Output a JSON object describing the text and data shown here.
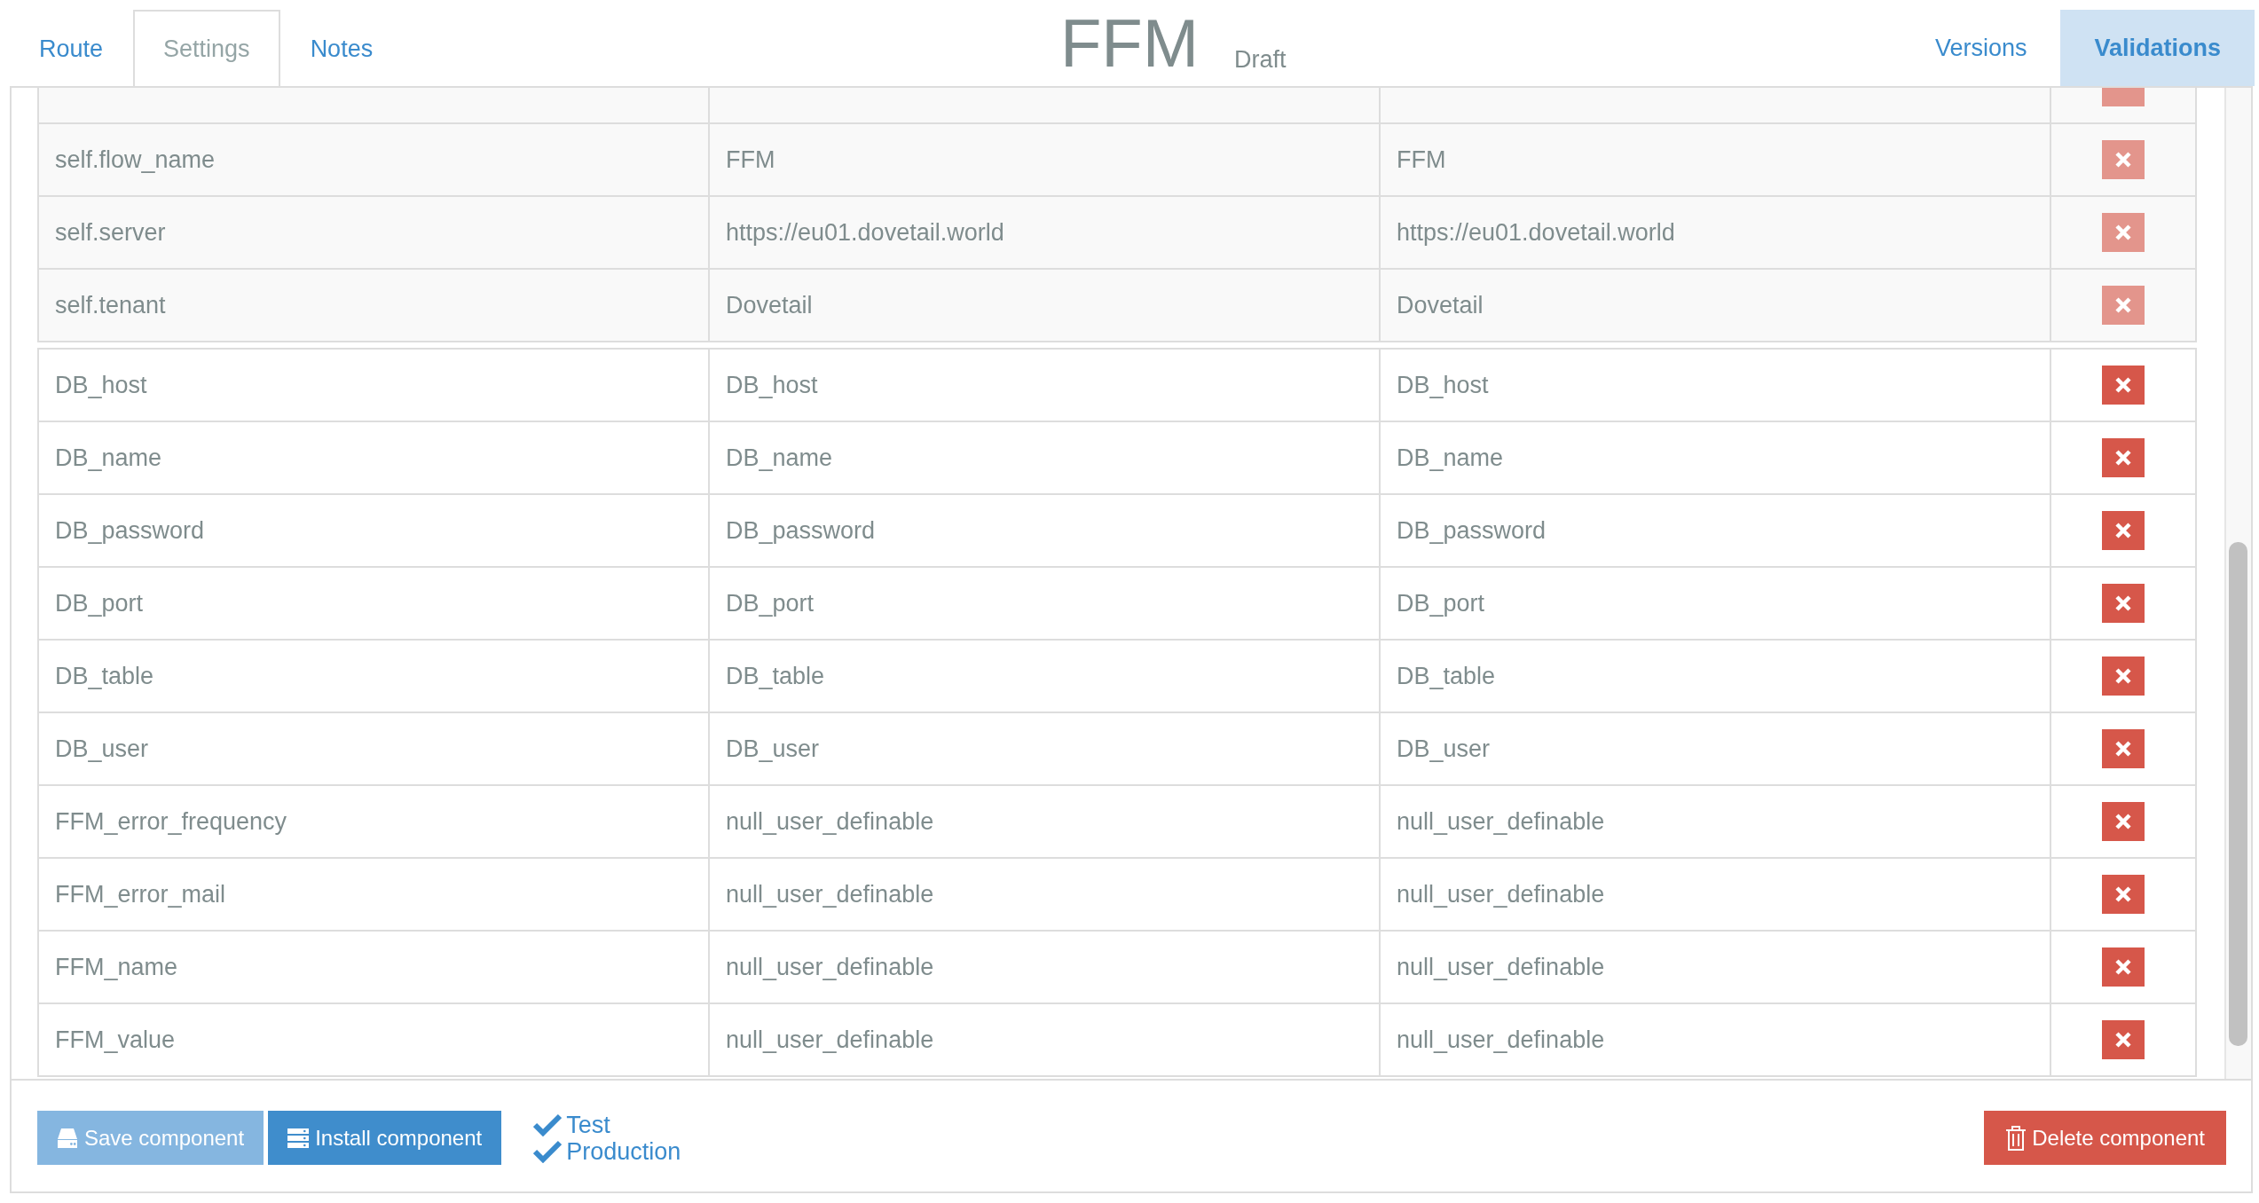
{
  "header": {
    "tabs_left": [
      {
        "label": "Route",
        "selected": false
      },
      {
        "label": "Settings",
        "selected": true
      },
      {
        "label": "Notes",
        "selected": false
      }
    ],
    "title": "FFM",
    "status": "Draft",
    "tabs_right": [
      {
        "label": "Versions",
        "selected": false
      },
      {
        "label": "Validations",
        "selected": true
      }
    ]
  },
  "table": {
    "groups": [
      {
        "disabled": true,
        "rows": [
          {
            "column_1": "self.flow_name",
            "column_2": "FFM",
            "column_3": "FFM"
          },
          {
            "column_1": "self.server",
            "column_2": "https://eu01.dovetail.world",
            "column_3": "https://eu01.dovetail.world"
          },
          {
            "column_1": "self.tenant",
            "column_2": "Dovetail",
            "column_3": "Dovetail"
          }
        ]
      },
      {
        "disabled": false,
        "rows": [
          {
            "column_1": "DB_host",
            "column_2": "DB_host",
            "column_3": "DB_host"
          },
          {
            "column_1": "DB_name",
            "column_2": "DB_name",
            "column_3": "DB_name"
          },
          {
            "column_1": "DB_password",
            "column_2": "DB_password",
            "column_3": "DB_password"
          },
          {
            "column_1": "DB_port",
            "column_2": "DB_port",
            "column_3": "DB_port"
          },
          {
            "column_1": "DB_table",
            "column_2": "DB_table",
            "column_3": "DB_table"
          },
          {
            "column_1": "DB_user",
            "column_2": "DB_user",
            "column_3": "DB_user"
          },
          {
            "column_1": "FFM_error_frequency",
            "column_2": "null_user_definable",
            "column_3": "null_user_definable"
          },
          {
            "column_1": "FFM_error_mail",
            "column_2": "null_user_definable",
            "column_3": "null_user_definable"
          },
          {
            "column_1": "FFM_name",
            "column_2": "null_user_definable",
            "column_3": "null_user_definable"
          },
          {
            "column_1": "FFM_value",
            "column_2": "null_user_definable",
            "column_3": "null_user_definable"
          }
        ]
      }
    ]
  },
  "footer": {
    "buttons": [
      {
        "kind": "save",
        "label": "Save component",
        "disabled": true
      },
      {
        "kind": "install",
        "label": "Install component",
        "disabled": false
      }
    ],
    "environments": [
      {
        "label": "Test",
        "checked": true
      },
      {
        "label": "Production",
        "checked": true
      }
    ],
    "delete_button": {
      "label": "Delete component"
    }
  }
}
